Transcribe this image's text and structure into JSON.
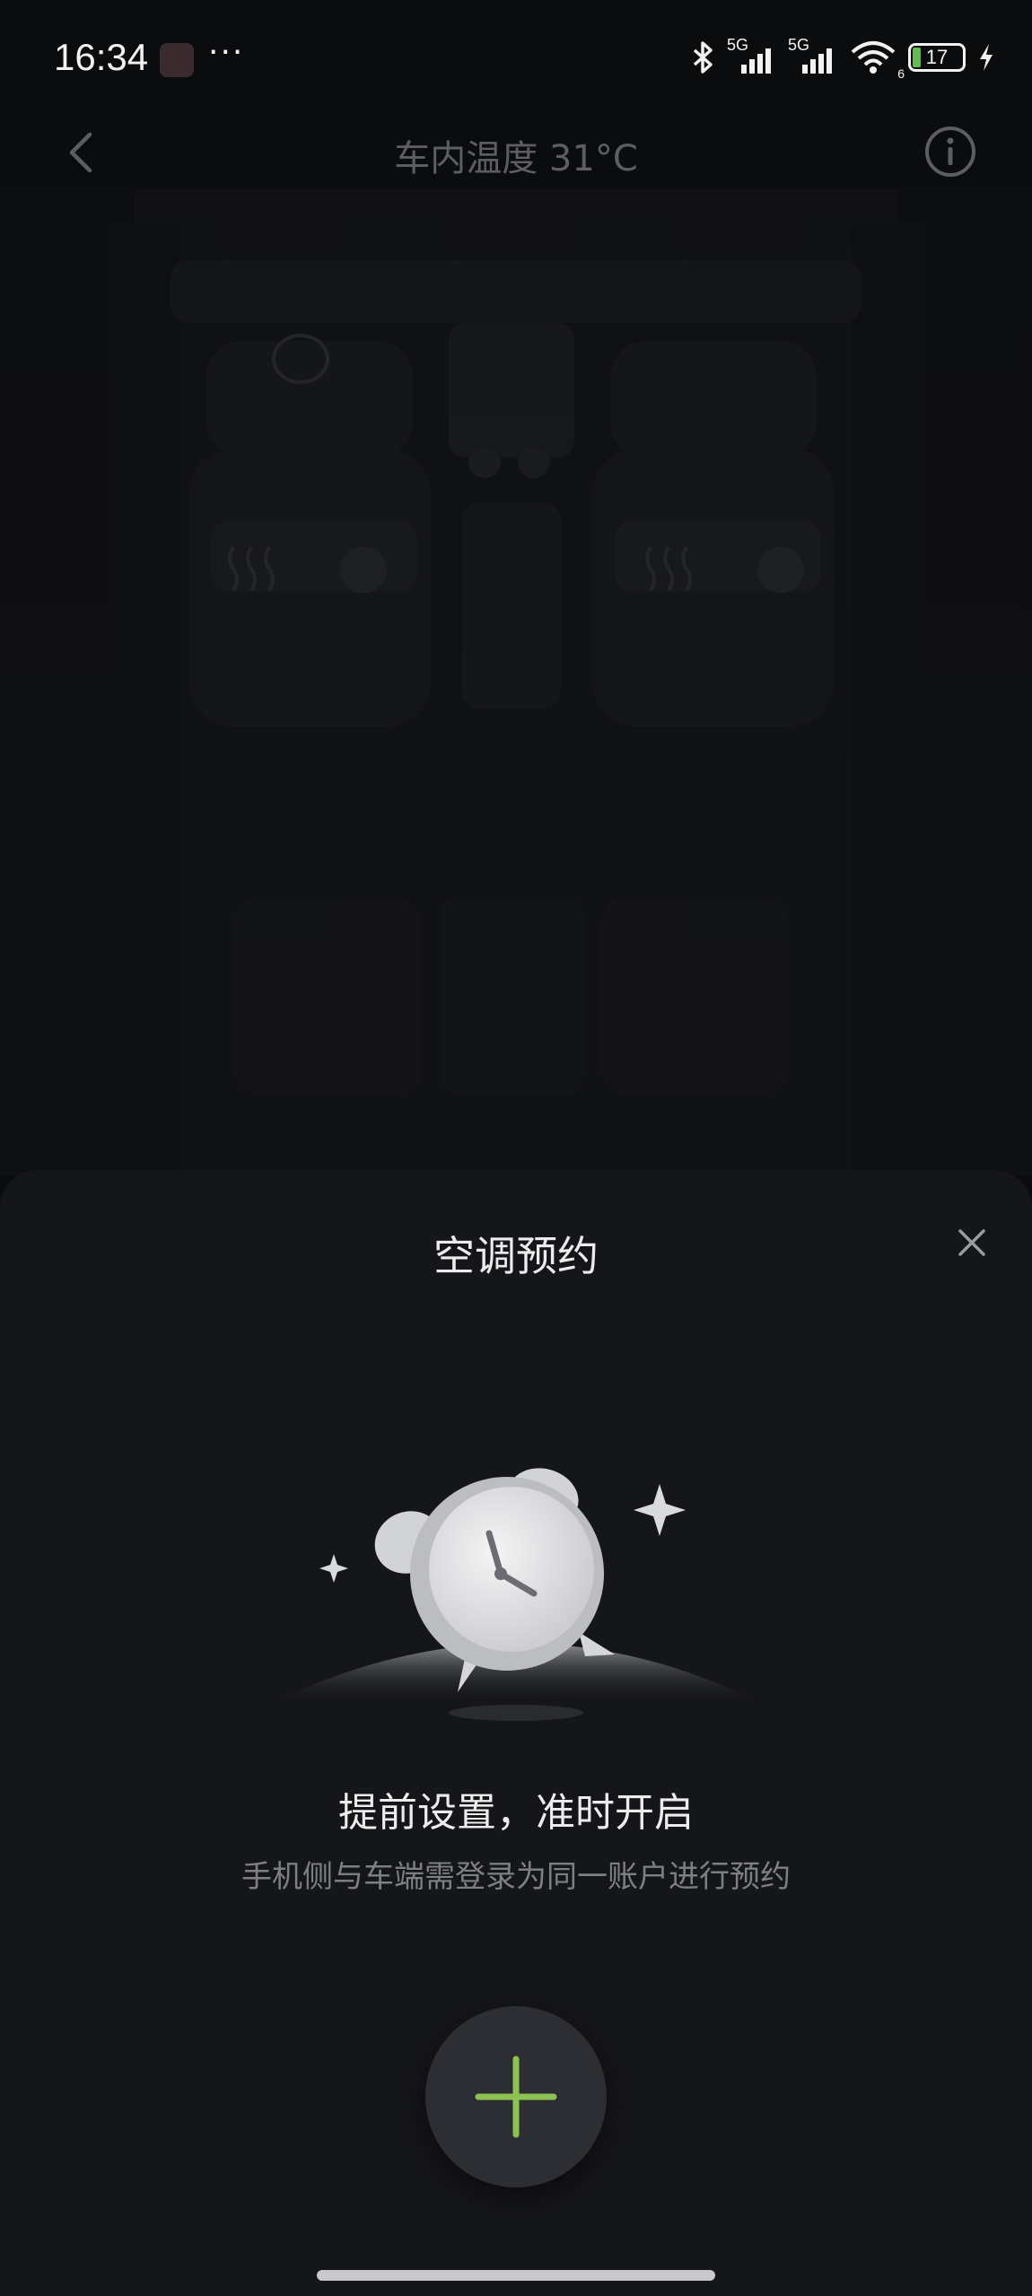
{
  "status_bar": {
    "time": "16:34",
    "more": "···",
    "network1": "5G",
    "network2": "5G",
    "wifi_label": "6",
    "battery": "17",
    "icons": [
      "bluetooth-icon",
      "signal-icon",
      "wifi-icon",
      "battery-icon",
      "charging-icon"
    ]
  },
  "nav": {
    "title": "车内温度 31°C",
    "back_icon": "chevron-left-icon",
    "info_icon": "info-icon"
  },
  "sheet": {
    "title": "空调预约",
    "headline": "提前设置，准时开启",
    "subtitle": "手机侧与车端需登录为同一账户进行预约",
    "close_icon": "close-icon",
    "add_icon": "plus-icon"
  },
  "colors": {
    "accent": "#8dc152",
    "sheet_bg": "#151619",
    "page_bg": "#0b0c0e"
  }
}
